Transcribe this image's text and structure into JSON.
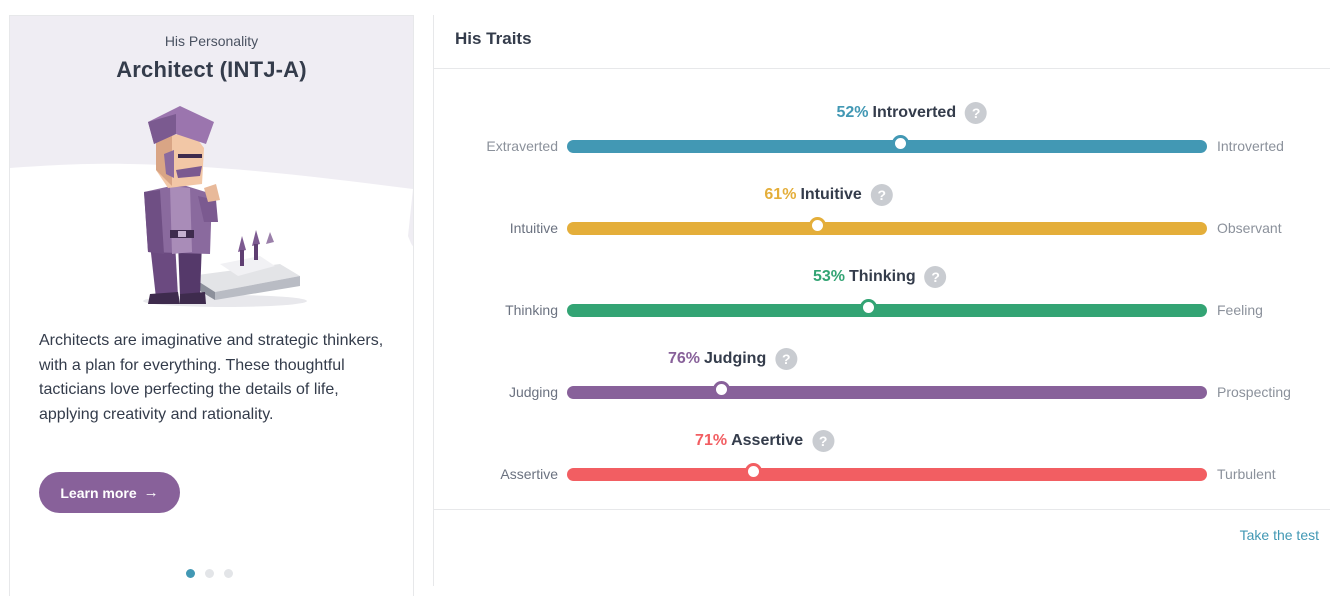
{
  "card": {
    "subtitle": "His Personality",
    "title": "Architect (INTJ-A)",
    "description": "Architects are imaginative and strategic thinkers, with a plan for everything. These thoughtful tacticians love perfecting the details of life, applying creativity and rationality.",
    "learn_more_label": "Learn more",
    "learn_more_icon": "arrow-right-icon",
    "carousel": {
      "count": 3,
      "active_index": 0
    }
  },
  "panel": {
    "title": "His Traits",
    "take_test_label": "Take the test",
    "traits": [
      {
        "left": "Extraverted",
        "right": "Introverted",
        "percent_label": "52%",
        "name": "Introverted",
        "dominant_side": "right",
        "percent": 52,
        "color": "#4298b4"
      },
      {
        "left": "Intuitive",
        "right": "Observant",
        "percent_label": "61%",
        "name": "Intuitive",
        "dominant_side": "left",
        "percent": 61,
        "color": "#e4ae3a"
      },
      {
        "left": "Thinking",
        "right": "Feeling",
        "percent_label": "53%",
        "name": "Thinking",
        "dominant_side": "left",
        "percent": 53,
        "color": "#33a474"
      },
      {
        "left": "Judging",
        "right": "Prospecting",
        "percent_label": "76%",
        "name": "Judging",
        "dominant_side": "left",
        "percent": 76,
        "color": "#88619a"
      },
      {
        "left": "Assertive",
        "right": "Turbulent",
        "percent_label": "71%",
        "name": "Assertive",
        "dominant_side": "left",
        "percent": 71,
        "color": "#f25e62"
      }
    ],
    "help_icon": "question-mark-icon"
  }
}
